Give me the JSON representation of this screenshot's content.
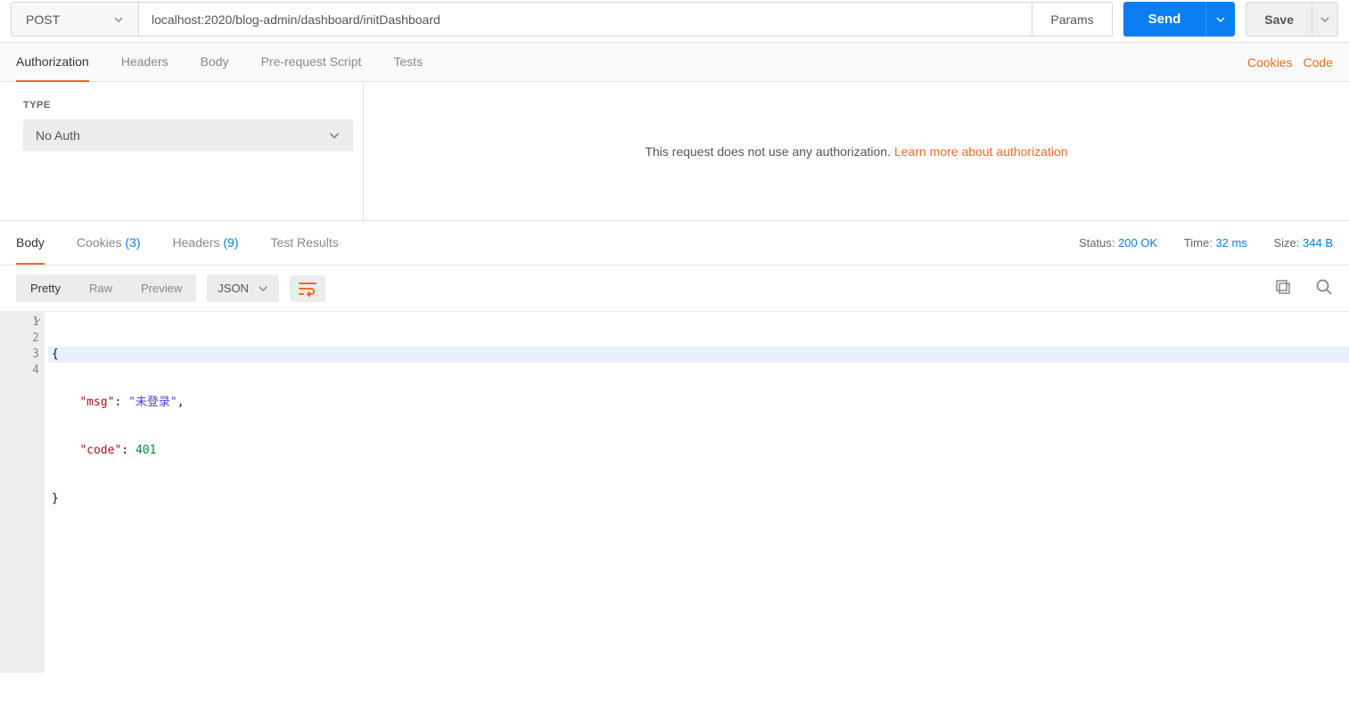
{
  "request": {
    "method": "POST",
    "url": "localhost:2020/blog-admin/dashboard/initDashboard",
    "params_label": "Params",
    "send_label": "Send",
    "save_label": "Save"
  },
  "request_tabs": {
    "authorization": "Authorization",
    "headers": "Headers",
    "body": "Body",
    "prescript": "Pre-request Script",
    "tests": "Tests",
    "cookies_link": "Cookies",
    "code_link": "Code"
  },
  "auth": {
    "type_label": "TYPE",
    "type_value": "No Auth",
    "message": "This request does not use any authorization.",
    "learn_more": "Learn more about authorization"
  },
  "response_tabs": {
    "body": "Body",
    "cookies_label": "Cookies",
    "cookies_count": "(3)",
    "headers_label": "Headers",
    "headers_count": "(9)",
    "test_results": "Test Results"
  },
  "response_meta": {
    "status_label": "Status:",
    "status_value": "200 OK",
    "time_label": "Time:",
    "time_value": "32 ms",
    "size_label": "Size:",
    "size_value": "344 B"
  },
  "viewer": {
    "pretty": "Pretty",
    "raw": "Raw",
    "preview": "Preview",
    "format": "JSON"
  },
  "response_body": {
    "line1": "{",
    "line2_key": "\"msg\"",
    "line2_val": "\"未登录\"",
    "line3_key": "\"code\"",
    "line3_val": "401",
    "line4": "}",
    "ln1": "1",
    "ln2": "2",
    "ln3": "3",
    "ln4": "4"
  }
}
